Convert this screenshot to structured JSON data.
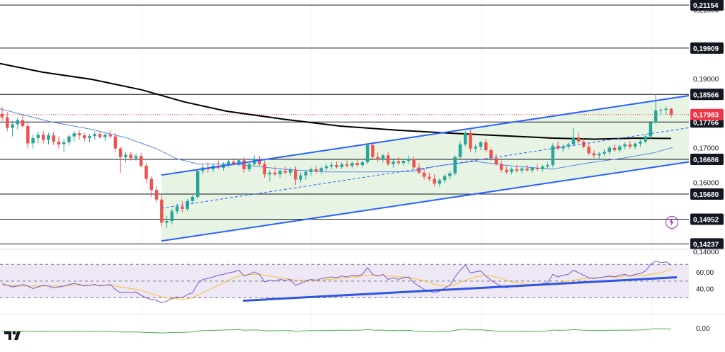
{
  "colors": {
    "up": "#26a69a",
    "down": "#ef5350",
    "channel": "#2962ff",
    "channel_fill": "#e3f1de",
    "ma200": "#000000",
    "ma50": "#5b86e5",
    "rsi_line": "#7e57c2",
    "rsi_ma": "#fbc02d",
    "rsi_band": "#ede7f6",
    "rsi_trend": "#2f56e0",
    "lower_line": "#4caf50",
    "current_price": "#f23645"
  },
  "icons": {
    "logo": "tradingview-logo-icon",
    "alert": "lightning-bolt-icon"
  },
  "chart_data": [
    {
      "type": "candlestick",
      "ylim": [
        0.1408,
        0.213
      ],
      "y_ticks": [
        "0,21000",
        "0,19000",
        "0,17000",
        "0,16000",
        "0,14000"
      ],
      "current_price": {
        "value": 0.17983,
        "label": "0,17983"
      },
      "levels": [
        {
          "value": 0.21154,
          "label": "0,21154"
        },
        {
          "value": 0.19909,
          "label": "0,19909"
        },
        {
          "value": 0.18566,
          "label": "0,18566"
        },
        {
          "value": 0.17766,
          "label": "0,17766"
        },
        {
          "value": 0.16686,
          "label": "0,16686"
        },
        {
          "value": 0.1568,
          "label": "0,15680"
        },
        {
          "value": 0.14952,
          "label": "0,14952"
        },
        {
          "value": 0.14237,
          "label": "0,14237"
        }
      ],
      "channel": {
        "upper": [
          [
            0.2226,
            0.1623
          ],
          [
            0.9502,
            0.1853
          ]
        ],
        "lower": [
          [
            0.2226,
            0.1432
          ],
          [
            0.9502,
            0.1661
          ]
        ],
        "mid": [
          [
            0.2226,
            0.1527
          ],
          [
            0.9502,
            0.176
          ]
        ]
      },
      "ma200": [
        [
          0.0,
          0.1946
        ],
        [
          0.0586,
          0.1921
        ],
        [
          0.127,
          0.19
        ],
        [
          0.1953,
          0.187
        ],
        [
          0.2539,
          0.1835
        ],
        [
          0.3125,
          0.1808
        ],
        [
          0.3906,
          0.1785
        ],
        [
          0.4688,
          0.1765
        ],
        [
          0.5469,
          0.1753
        ],
        [
          0.625,
          0.1744
        ],
        [
          0.6934,
          0.1737
        ],
        [
          0.7617,
          0.173
        ],
        [
          0.8203,
          0.1727
        ],
        [
          0.8789,
          0.173
        ],
        [
          0.9258,
          0.1729
        ]
      ],
      "ma50": [
        [
          0.0,
          0.1815
        ],
        [
          0.0684,
          0.1778
        ],
        [
          0.127,
          0.1755
        ],
        [
          0.1758,
          0.173
        ],
        [
          0.2148,
          0.17
        ],
        [
          0.2441,
          0.167
        ],
        [
          0.2734,
          0.1655
        ],
        [
          0.3223,
          0.1655
        ],
        [
          0.3906,
          0.164
        ],
        [
          0.4492,
          0.1632
        ],
        [
          0.5078,
          0.1632
        ],
        [
          0.5664,
          0.1633
        ],
        [
          0.6055,
          0.165
        ],
        [
          0.6543,
          0.1663
        ],
        [
          0.7031,
          0.165
        ],
        [
          0.7617,
          0.164
        ],
        [
          0.8105,
          0.1658
        ],
        [
          0.8594,
          0.1672
        ],
        [
          0.9023,
          0.1688
        ],
        [
          0.9277,
          0.1703
        ]
      ],
      "candles": [
        [
          0.18,
          0.182,
          0.178,
          0.179
        ],
        [
          0.179,
          0.1805,
          0.175,
          0.176
        ],
        [
          0.176,
          0.178,
          0.1735,
          0.177
        ],
        [
          0.177,
          0.179,
          0.1755,
          0.1782
        ],
        [
          0.1782,
          0.18,
          0.176,
          0.1765
        ],
        [
          0.1765,
          0.1775,
          0.17,
          0.1715
        ],
        [
          0.1715,
          0.174,
          0.17,
          0.173
        ],
        [
          0.173,
          0.1748,
          0.1715,
          0.174
        ],
        [
          0.174,
          0.175,
          0.1715,
          0.1725
        ],
        [
          0.1725,
          0.1745,
          0.1712,
          0.1738
        ],
        [
          0.1738,
          0.1748,
          0.171,
          0.172
        ],
        [
          0.172,
          0.1735,
          0.17,
          0.1712
        ],
        [
          0.1712,
          0.1728,
          0.169,
          0.1718
        ],
        [
          0.1718,
          0.174,
          0.1708,
          0.1735
        ],
        [
          0.1735,
          0.175,
          0.172,
          0.1744
        ],
        [
          0.1744,
          0.1752,
          0.1725,
          0.1738
        ],
        [
          0.1738,
          0.1745,
          0.172,
          0.173
        ],
        [
          0.173,
          0.1742,
          0.1718,
          0.1736
        ],
        [
          0.1736,
          0.1748,
          0.1725,
          0.1742
        ],
        [
          0.1742,
          0.175,
          0.1728,
          0.1733
        ],
        [
          0.1733,
          0.1745,
          0.1722,
          0.174
        ],
        [
          0.174,
          0.1752,
          0.173,
          0.1735
        ],
        [
          0.1735,
          0.1745,
          0.169,
          0.17
        ],
        [
          0.17,
          0.1705,
          0.163,
          0.1675
        ],
        [
          0.1675,
          0.169,
          0.166,
          0.1682
        ],
        [
          0.1682,
          0.169,
          0.1665,
          0.1672
        ],
        [
          0.1672,
          0.1685,
          0.1665,
          0.1678
        ],
        [
          0.1678,
          0.1688,
          0.1645,
          0.165
        ],
        [
          0.165,
          0.1658,
          0.16,
          0.1612
        ],
        [
          0.1612,
          0.162,
          0.156,
          0.158
        ],
        [
          0.158,
          0.1592,
          0.1545,
          0.1552
        ],
        [
          0.1552,
          0.1565,
          0.1475,
          0.1485
        ],
        [
          0.1485,
          0.1505,
          0.147,
          0.149
        ],
        [
          0.149,
          0.1525,
          0.148,
          0.1518
        ],
        [
          0.1518,
          0.154,
          0.151,
          0.1532
        ],
        [
          0.1532,
          0.1548,
          0.1515,
          0.1525
        ],
        [
          0.1525,
          0.1555,
          0.1518,
          0.1548
        ],
        [
          0.1548,
          0.1568,
          0.154,
          0.156
        ],
        [
          0.156,
          0.164,
          0.1555,
          0.1635
        ],
        [
          0.1635,
          0.1655,
          0.1625,
          0.1645
        ],
        [
          0.1645,
          0.166,
          0.163,
          0.164
        ],
        [
          0.164,
          0.1655,
          0.1632,
          0.165
        ],
        [
          0.165,
          0.1665,
          0.164,
          0.1644
        ],
        [
          0.1644,
          0.166,
          0.1636,
          0.1655
        ],
        [
          0.1655,
          0.167,
          0.1645,
          0.1662
        ],
        [
          0.1662,
          0.1672,
          0.165,
          0.1656
        ],
        [
          0.1656,
          0.167,
          0.1648,
          0.1666
        ],
        [
          0.1666,
          0.1675,
          0.163,
          0.164
        ],
        [
          0.164,
          0.166,
          0.1632,
          0.1655
        ],
        [
          0.1655,
          0.168,
          0.1648,
          0.167
        ],
        [
          0.167,
          0.1678,
          0.165,
          0.1655
        ],
        [
          0.1655,
          0.1665,
          0.1615,
          0.1625
        ],
        [
          0.1625,
          0.1638,
          0.1605,
          0.163
        ],
        [
          0.163,
          0.1648,
          0.162,
          0.1625
        ],
        [
          0.1625,
          0.164,
          0.1615,
          0.1635
        ],
        [
          0.1635,
          0.1648,
          0.1625,
          0.163
        ],
        [
          0.163,
          0.1645,
          0.162,
          0.1638
        ],
        [
          0.1638,
          0.1648,
          0.1595,
          0.161
        ],
        [
          0.161,
          0.163,
          0.1602,
          0.1622
        ],
        [
          0.1622,
          0.1638,
          0.161,
          0.1632
        ],
        [
          0.1632,
          0.1645,
          0.1622,
          0.164
        ],
        [
          0.164,
          0.165,
          0.1628,
          0.1635
        ],
        [
          0.1635,
          0.1648,
          0.1625,
          0.1643
        ],
        [
          0.1643,
          0.1655,
          0.1635,
          0.1648
        ],
        [
          0.1648,
          0.166,
          0.164,
          0.1652
        ],
        [
          0.1652,
          0.1662,
          0.1642,
          0.1646
        ],
        [
          0.1646,
          0.166,
          0.164,
          0.1654
        ],
        [
          0.1654,
          0.1665,
          0.1645,
          0.165
        ],
        [
          0.165,
          0.1662,
          0.1642,
          0.1658
        ],
        [
          0.1658,
          0.1668,
          0.1648,
          0.1652
        ],
        [
          0.1652,
          0.1665,
          0.1645,
          0.166
        ],
        [
          0.166,
          0.1715,
          0.1655,
          0.171
        ],
        [
          0.171,
          0.1718,
          0.167,
          0.1675
        ],
        [
          0.1675,
          0.169,
          0.166,
          0.1668
        ],
        [
          0.1668,
          0.1685,
          0.166,
          0.168
        ],
        [
          0.168,
          0.169,
          0.165,
          0.1655
        ],
        [
          0.1655,
          0.1668,
          0.1645,
          0.1662
        ],
        [
          0.1662,
          0.1675,
          0.1652,
          0.1658
        ],
        [
          0.1658,
          0.167,
          0.165,
          0.1664
        ],
        [
          0.1664,
          0.168,
          0.1655,
          0.167
        ],
        [
          0.167,
          0.1678,
          0.164,
          0.1645
        ],
        [
          0.1645,
          0.1658,
          0.1625,
          0.163
        ],
        [
          0.163,
          0.164,
          0.161,
          0.1618
        ],
        [
          0.1618,
          0.163,
          0.1605,
          0.1612
        ],
        [
          0.1612,
          0.1625,
          0.159,
          0.1598
        ],
        [
          0.1598,
          0.1615,
          0.159,
          0.1608
        ],
        [
          0.1608,
          0.1625,
          0.16,
          0.162
        ],
        [
          0.162,
          0.1635,
          0.1612,
          0.1628
        ],
        [
          0.1628,
          0.168,
          0.1622,
          0.1675
        ],
        [
          0.1675,
          0.172,
          0.1668,
          0.1712
        ],
        [
          0.1712,
          0.175,
          0.1705,
          0.1745
        ],
        [
          0.1745,
          0.1755,
          0.169,
          0.17
        ],
        [
          0.17,
          0.1712,
          0.1688,
          0.1705
        ],
        [
          0.1705,
          0.1722,
          0.1695,
          0.1718
        ],
        [
          0.1718,
          0.1728,
          0.169,
          0.1695
        ],
        [
          0.1695,
          0.1705,
          0.1665,
          0.1672
        ],
        [
          0.1672,
          0.1685,
          0.165,
          0.1655
        ],
        [
          0.1655,
          0.1665,
          0.163,
          0.1638
        ],
        [
          0.1638,
          0.1648,
          0.1625,
          0.1632
        ],
        [
          0.1632,
          0.1645,
          0.1625,
          0.164
        ],
        [
          0.164,
          0.1652,
          0.163,
          0.1636
        ],
        [
          0.1636,
          0.1648,
          0.1628,
          0.1642
        ],
        [
          0.1642,
          0.1652,
          0.1632,
          0.1637
        ],
        [
          0.1637,
          0.1648,
          0.163,
          0.1644
        ],
        [
          0.1644,
          0.1655,
          0.1635,
          0.164
        ],
        [
          0.164,
          0.1652,
          0.1632,
          0.1648
        ],
        [
          0.1648,
          0.166,
          0.164,
          0.1652
        ],
        [
          0.1652,
          0.1715,
          0.1645,
          0.1708
        ],
        [
          0.1708,
          0.172,
          0.1695,
          0.17
        ],
        [
          0.17,
          0.1712,
          0.169,
          0.1706
        ],
        [
          0.1706,
          0.1718,
          0.1698,
          0.1712
        ],
        [
          0.1712,
          0.176,
          0.1705,
          0.1732
        ],
        [
          0.1732,
          0.1745,
          0.1715,
          0.172
        ],
        [
          0.172,
          0.173,
          0.17,
          0.1705
        ],
        [
          0.1705,
          0.1715,
          0.168,
          0.1686
        ],
        [
          0.1686,
          0.1695,
          0.1672,
          0.168
        ],
        [
          0.168,
          0.169,
          0.1668,
          0.1685
        ],
        [
          0.1685,
          0.1698,
          0.1678,
          0.169
        ],
        [
          0.169,
          0.1708,
          0.1682,
          0.1702
        ],
        [
          0.1702,
          0.1712,
          0.169,
          0.1695
        ],
        [
          0.1695,
          0.171,
          0.1688,
          0.1706
        ],
        [
          0.1706,
          0.1718,
          0.1698,
          0.1712
        ],
        [
          0.1712,
          0.1722,
          0.17,
          0.1705
        ],
        [
          0.1705,
          0.1718,
          0.1698,
          0.1714
        ],
        [
          0.1714,
          0.1726,
          0.1705,
          0.172
        ],
        [
          0.172,
          0.174,
          0.1715,
          0.1735
        ],
        [
          0.1735,
          0.178,
          0.1728,
          0.1775
        ],
        [
          0.1775,
          0.1858,
          0.177,
          0.181
        ],
        [
          0.181,
          0.1818,
          0.1795,
          0.1812
        ],
        [
          0.1812,
          0.1822,
          0.1798,
          0.1815
        ],
        [
          0.1815,
          0.1818,
          0.179,
          0.1798
        ]
      ],
      "rsi": {
        "ylim": [
          16,
          88
        ],
        "y_ticks": [
          "60,00",
          "40,00"
        ],
        "bands": [
          70,
          50,
          30
        ],
        "trendline": [
          [
            0.335,
            26.5
          ],
          [
            0.9336,
            54.5
          ]
        ],
        "values": [
          47,
          45,
          43,
          44,
          46,
          44,
          41,
          43,
          45,
          44,
          42,
          43,
          44,
          46,
          47,
          46,
          44,
          45,
          46,
          44,
          45,
          46,
          40,
          36,
          37,
          36,
          37,
          33,
          30,
          28,
          27,
          24,
          26,
          29,
          31,
          30,
          34,
          36,
          47,
          52,
          53,
          55,
          57,
          58,
          60,
          61,
          63,
          56,
          58,
          61,
          58,
          49,
          51,
          50,
          52,
          51,
          52,
          45,
          47,
          50,
          52,
          51,
          53,
          54,
          55,
          54,
          56,
          55,
          57,
          56,
          58,
          66,
          58,
          56,
          58,
          52,
          54,
          52,
          54,
          55,
          48,
          44,
          40,
          38,
          36,
          38,
          42,
          45,
          55,
          63,
          69,
          60,
          61,
          62,
          56,
          51,
          47,
          44,
          42,
          44,
          43,
          45,
          44,
          46,
          45,
          47,
          48,
          58,
          55,
          57,
          58,
          63,
          60,
          57,
          54,
          53,
          54,
          55,
          56,
          55,
          57,
          58,
          56,
          58,
          59,
          62,
          70,
          74,
          72,
          73,
          69
        ],
        "ma": [
          45,
          45,
          45,
          44,
          44,
          44,
          44,
          44,
          44,
          44,
          44,
          44,
          44,
          44,
          45,
          45,
          45,
          45,
          45,
          45,
          45,
          45,
          44,
          43,
          42,
          41,
          40,
          39,
          37,
          35,
          33,
          31,
          30,
          29,
          29,
          28,
          29,
          30,
          33,
          36,
          39,
          42,
          45,
          48,
          51,
          54,
          56,
          57,
          58,
          58,
          58,
          57,
          56,
          55,
          54,
          53,
          52,
          51,
          51,
          51,
          51,
          51,
          51,
          52,
          52,
          53,
          53,
          54,
          55,
          55,
          56,
          57,
          57,
          57,
          57,
          56,
          56,
          55,
          55,
          54,
          53,
          52,
          50,
          48,
          46,
          45,
          44,
          44,
          46,
          48,
          51,
          53,
          55,
          56,
          57,
          56,
          55,
          53,
          51,
          49,
          48,
          47,
          46,
          46,
          46,
          46,
          46,
          47,
          48,
          49,
          50,
          51,
          52,
          53,
          53,
          54,
          54,
          55,
          55,
          55,
          55,
          56,
          56,
          56,
          57,
          57,
          58,
          59,
          60,
          62,
          64
        ]
      },
      "lower_indicator": {
        "zero_label": "0,00"
      }
    }
  ]
}
